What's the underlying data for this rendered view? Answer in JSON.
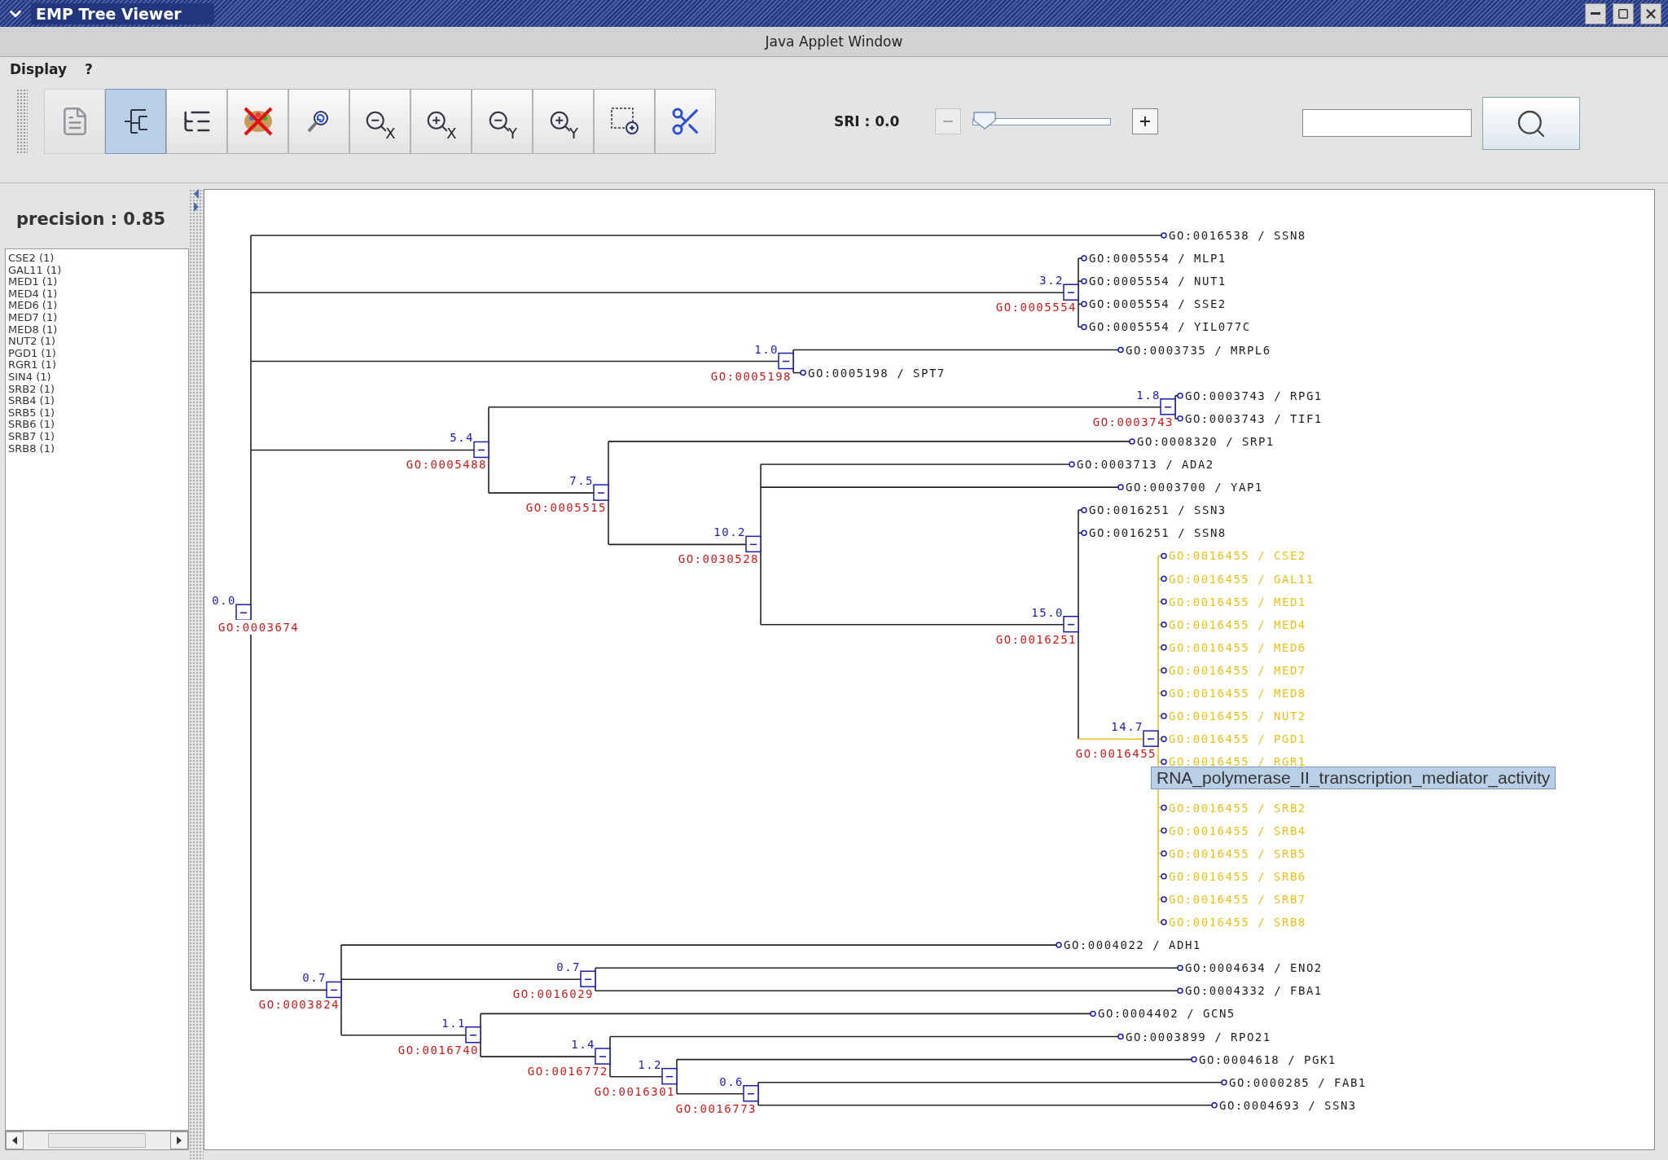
{
  "window": {
    "title": "EMP Tree Viewer"
  },
  "applet_bar": "Java Applet Window",
  "menu": [
    {
      "label": "Display"
    },
    {
      "label": "?"
    }
  ],
  "toolbar": [
    {
      "kind": "pdf",
      "selected": false,
      "disabled": true
    },
    {
      "kind": "tree-rect",
      "selected": true,
      "disabled": false
    },
    {
      "kind": "tree-list",
      "selected": false,
      "disabled": false
    },
    {
      "kind": "color-off",
      "selected": false,
      "disabled": false
    },
    {
      "kind": "zoom-reset",
      "selected": false,
      "disabled": false
    },
    {
      "kind": "zoom-out",
      "axis": "X",
      "selected": false,
      "disabled": false
    },
    {
      "kind": "zoom-in",
      "axis": "X",
      "selected": false,
      "disabled": false
    },
    {
      "kind": "zoom-out",
      "axis": "Y",
      "selected": false,
      "disabled": false
    },
    {
      "kind": "zoom-in",
      "axis": "Y",
      "selected": false,
      "disabled": false
    },
    {
      "kind": "zoom-area",
      "selected": false,
      "disabled": false
    },
    {
      "kind": "cut",
      "selected": false,
      "disabled": false
    }
  ],
  "sri": {
    "label": "SRI : 0.0",
    "level": 0,
    "minus": {
      "disabled": true
    },
    "plus": {
      "disabled": false
    }
  },
  "precision": "precision : 0.85",
  "genes": [
    "CSE2 (1)",
    "GAL11 (1)",
    "MED1 (1)",
    "MED4 (1)",
    "MED6 (1)",
    "MED7 (1)",
    "MED8 (1)",
    "NUT2 (1)",
    "PGD1 (1)",
    "RGR1 (1)",
    "SIN4 (1)",
    "SRB2 (1)",
    "SRB4 (1)",
    "SRB5 (1)",
    "SRB6 (1)",
    "SRB7 (1)",
    "SRB8 (1)"
  ],
  "tree": {
    "kind": "node",
    "score": "0.0",
    "term": "GO:0003674",
    "expanded": true,
    "highlighted": false,
    "children": [
      {
        "kind": "leaf",
        "label": "GO:0016538 / SSN8"
      },
      {
        "kind": "node",
        "score": "3.2",
        "term": "GO:0005554",
        "expanded": true,
        "highlighted": false,
        "children": [
          {
            "kind": "leaf",
            "label": "GO:0005554 / MLP1"
          },
          {
            "kind": "leaf",
            "label": "GO:0005554 / NUT1"
          },
          {
            "kind": "leaf",
            "label": "GO:0005554 / SSE2"
          },
          {
            "kind": "leaf",
            "label": "GO:0005554 / YIL077C"
          }
        ]
      },
      {
        "kind": "node",
        "score": "1.0",
        "term": "GO:0005198",
        "expanded": true,
        "highlighted": false,
        "children": [
          {
            "kind": "leaf",
            "label": "GO:0003735 / MRPL6"
          },
          {
            "kind": "leaf",
            "label": "GO:0005198 / SPT7"
          }
        ]
      },
      {
        "kind": "node",
        "score": "5.4",
        "term": "GO:0005488",
        "expanded": true,
        "highlighted": false,
        "children": [
          {
            "kind": "node",
            "score": "1.8",
            "term": "GO:0003743",
            "expanded": true,
            "highlighted": false,
            "children": [
              {
                "kind": "leaf",
                "label": "GO:0003743 / RPG1"
              },
              {
                "kind": "leaf",
                "label": "GO:0003743 / TIF1"
              }
            ]
          },
          {
            "kind": "node",
            "score": "7.5",
            "term": "GO:0005515",
            "expanded": true,
            "highlighted": false,
            "children": [
              {
                "kind": "leaf",
                "label": "GO:0008320 / SRP1"
              },
              {
                "kind": "node",
                "score": "10.2",
                "term": "GO:0030528",
                "expanded": true,
                "highlighted": false,
                "children": [
                  {
                    "kind": "leaf",
                    "label": "GO:0003713 / ADA2"
                  },
                  {
                    "kind": "leaf",
                    "label": "GO:0003700 / YAP1"
                  },
                  {
                    "kind": "node",
                    "score": "15.0",
                    "term": "GO:0016251",
                    "expanded": true,
                    "highlighted": false,
                    "children": [
                      {
                        "kind": "leaf",
                        "label": "GO:0016251 / SSN3"
                      },
                      {
                        "kind": "leaf",
                        "label": "GO:0016251 / SSN8"
                      },
                      {
                        "kind": "node",
                        "score": "14.7",
                        "term": "GO:0016455",
                        "expanded": true,
                        "highlighted": true,
                        "children": [
                          {
                            "kind": "leaf",
                            "label": "GO:0016455 / CSE2"
                          },
                          {
                            "kind": "leaf",
                            "label": "GO:0016455 / GAL11"
                          },
                          {
                            "kind": "leaf",
                            "label": "GO:0016455 / MED1"
                          },
                          {
                            "kind": "leaf",
                            "label": "GO:0016455 / MED4"
                          },
                          {
                            "kind": "leaf",
                            "label": "GO:0016455 / MED6"
                          },
                          {
                            "kind": "leaf",
                            "label": "GO:0016455 / MED7"
                          },
                          {
                            "kind": "leaf",
                            "label": "GO:0016455 / MED8"
                          },
                          {
                            "kind": "leaf",
                            "label": "GO:0016455 / NUT2"
                          },
                          {
                            "kind": "leaf",
                            "label": "GO:0016455 / PGD1"
                          },
                          {
                            "kind": "leaf",
                            "label": "GO:0016455 / RGR1"
                          },
                          {
                            "kind": "tooltip",
                            "text": "RNA_polymerase_II_transcription_mediator_activity"
                          },
                          {
                            "kind": "leaf",
                            "label": "GO:0016455 / SRB2"
                          },
                          {
                            "kind": "leaf",
                            "label": "GO:0016455 / SRB4"
                          },
                          {
                            "kind": "leaf",
                            "label": "GO:0016455 / SRB5"
                          },
                          {
                            "kind": "leaf",
                            "label": "GO:0016455 / SRB6"
                          },
                          {
                            "kind": "leaf",
                            "label": "GO:0016455 / SRB7"
                          },
                          {
                            "kind": "leaf",
                            "label": "GO:0016455 / SRB8"
                          }
                        ]
                      }
                    ]
                  }
                ]
              }
            ]
          }
        ]
      },
      {
        "kind": "node",
        "score": "0.7",
        "term": "GO:0003824",
        "expanded": true,
        "highlighted": false,
        "children": [
          {
            "kind": "leaf",
            "label": "GO:0004022 / ADH1"
          },
          {
            "kind": "node",
            "score": "0.7",
            "term": "GO:0016029",
            "expanded": true,
            "highlighted": false,
            "children": [
              {
                "kind": "leaf",
                "label": "GO:0004634 / ENO2"
              },
              {
                "kind": "leaf",
                "label": "GO:0004332 / FBA1"
              }
            ]
          },
          {
            "kind": "node",
            "score": "1.1",
            "term": "GO:0016740",
            "expanded": true,
            "highlighted": false,
            "children": [
              {
                "kind": "leaf",
                "label": "GO:0004402 / GCN5"
              },
              {
                "kind": "node",
                "score": "1.4",
                "term": "GO:0016772",
                "expanded": true,
                "highlighted": false,
                "children": [
                  {
                    "kind": "leaf",
                    "label": "GO:0003899 / RPO21"
                  },
                  {
                    "kind": "node",
                    "score": "1.2",
                    "term": "GO:0016301",
                    "expanded": true,
                    "highlighted": false,
                    "children": [
                      {
                        "kind": "leaf",
                        "label": "GO:0004618 / PGK1"
                      },
                      {
                        "kind": "node",
                        "score": "0.6",
                        "term": "GO:0016773",
                        "expanded": true,
                        "highlighted": false,
                        "children": [
                          {
                            "kind": "leaf",
                            "label": "GO:0000285 / FAB1"
                          },
                          {
                            "kind": "leaf",
                            "label": "GO:0004693 / SSN3"
                          }
                        ]
                      }
                    ]
                  }
                ]
              }
            ]
          }
        ]
      }
    ]
  }
}
